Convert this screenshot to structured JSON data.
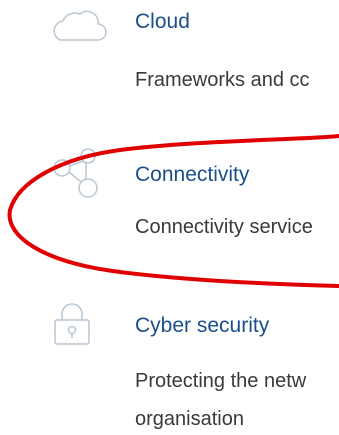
{
  "items": [
    {
      "icon": "cloud-icon",
      "title": "Cloud",
      "description": "Frameworks and cc"
    },
    {
      "icon": "connectivity-nodes-icon",
      "title": "Connectivity",
      "description": "Connectivity service"
    },
    {
      "icon": "lock-icon",
      "title": "Cyber security",
      "description_lines": [
        "Protecting the netw",
        "organisation"
      ]
    }
  ],
  "colors": {
    "title": "#1b4f8a",
    "text": "#3a3a3a",
    "icon": "#b9c6d2",
    "annotation": "#e00000"
  }
}
